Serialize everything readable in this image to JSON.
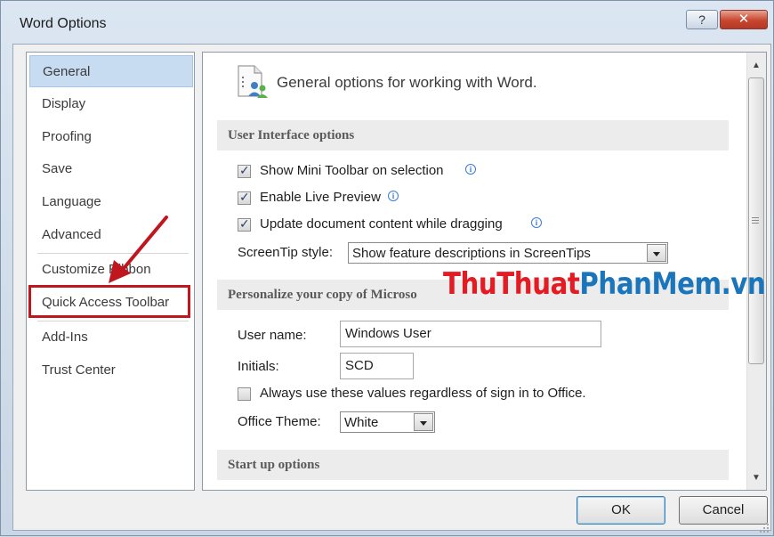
{
  "window": {
    "title": "Word Options",
    "help_label": "?",
    "close_label": "✕"
  },
  "nav": {
    "items": [
      {
        "label": "General",
        "selected": true
      },
      {
        "label": "Display"
      },
      {
        "label": "Proofing"
      },
      {
        "label": "Save"
      },
      {
        "label": "Language"
      },
      {
        "label": "Advanced"
      },
      {
        "label": "Customize Ribbon"
      },
      {
        "label": "Quick Access Toolbar",
        "highlighted": true
      },
      {
        "label": "Add-Ins"
      },
      {
        "label": "Trust Center"
      }
    ]
  },
  "content": {
    "header": "General options for working with Word.",
    "header_icon": "general-options-icon",
    "ui_section": {
      "title": "User Interface options",
      "options": [
        {
          "label": "Show Mini Toolbar on selection",
          "checked": true,
          "info": true
        },
        {
          "label": "Enable Live Preview",
          "checked": true,
          "info": true
        },
        {
          "label": "Update document content while dragging",
          "checked": true,
          "info": true
        }
      ],
      "screentip_label": "ScreenTip style:",
      "screentip_value": "Show feature descriptions in ScreenTips"
    },
    "personalize_section": {
      "title": "Personalize your copy of Microso",
      "username_label": "User name:",
      "username_value": "Windows User",
      "initials_label": "Initials:",
      "initials_value": "SCD",
      "always_use_label": "Always use these values regardless of sign in to Office.",
      "always_use_checked": false,
      "theme_label": "Office Theme:",
      "theme_value": "White"
    },
    "startup_section": {
      "title": "Start up options"
    }
  },
  "buttons": {
    "ok": "OK",
    "cancel": "Cancel"
  },
  "watermark": {
    "part1": "ThuThuat",
    "part2": "PhanMem.vn"
  },
  "colors": {
    "highlight_box": "#c0161e",
    "arrow": "#c0161e",
    "selected_nav": "#c8dcf1"
  }
}
